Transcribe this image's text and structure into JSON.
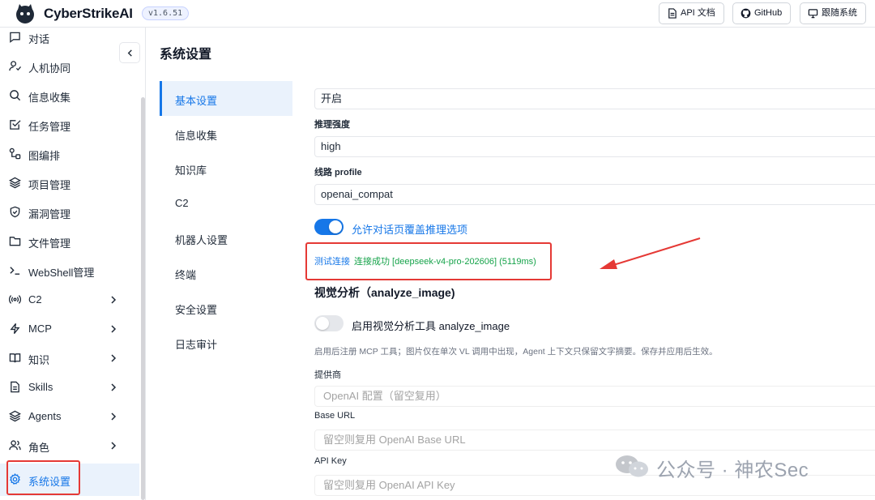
{
  "header": {
    "brand": "CyberStrikeAI",
    "version": "v1.6.51",
    "buttons": [
      {
        "label": "API 文档",
        "icon": "document-icon"
      },
      {
        "label": "GitHub",
        "icon": "github-icon"
      },
      {
        "label": "跟随系统",
        "icon": "monitor-icon"
      }
    ]
  },
  "sidebar": {
    "items": [
      {
        "label": "对话",
        "icon": "chat-icon"
      },
      {
        "label": "人机协同",
        "icon": "user-check-icon"
      },
      {
        "label": "信息收集",
        "icon": "search-icon"
      },
      {
        "label": "任务管理",
        "icon": "task-check-icon"
      },
      {
        "label": "图编排",
        "icon": "workflow-icon"
      },
      {
        "label": "项目管理",
        "icon": "layers-icon"
      },
      {
        "label": "漏洞管理",
        "icon": "shield-icon"
      },
      {
        "label": "文件管理",
        "icon": "folder-icon"
      },
      {
        "label": "WebShell管理",
        "icon": "terminal-icon"
      },
      {
        "label": "C2",
        "icon": "broadcast-icon",
        "expandable": true
      },
      {
        "label": "MCP",
        "icon": "bolt-icon",
        "expandable": true
      },
      {
        "label": "知识",
        "icon": "book-icon",
        "expandable": true
      },
      {
        "label": "Skills",
        "icon": "file-text-icon",
        "expandable": true
      },
      {
        "label": "Agents",
        "icon": "layers-icon",
        "expandable": true
      },
      {
        "label": "角色",
        "icon": "users-icon",
        "expandable": true
      },
      {
        "label": "系统设置",
        "icon": "gear-icon",
        "active": true
      }
    ]
  },
  "main": {
    "title": "系统设置",
    "subnav": [
      "基本设置",
      "信息收集",
      "知识库",
      "C2",
      "机器人设置",
      "终端",
      "安全设置",
      "日志审计"
    ],
    "active_subnav": "基本设置",
    "fields": {
      "thinking_value": "开启",
      "reasoning_label": "推理强度",
      "reasoning_value": "high",
      "profile_label": "线路 profile",
      "profile_value": "openai_compat",
      "override_toggle_label": "允许对话页覆盖推理选项",
      "override_toggle_on": true,
      "test_link": "测试连接",
      "test_result": "连接成功 [deepseek-v4-pro-202606] (5119ms)",
      "vision_section_title": "视觉分析（analyze_image)",
      "vision_toggle_label": "启用视觉分析工具 analyze_image",
      "vision_toggle_on": false,
      "vision_hint": "启用后注册 MCP 工具；图片仅在单次 VL 调用中出现，Agent 上下文只保留文字摘要。保存并应用后生效。",
      "provider_label": "提供商",
      "provider_placeholder": "OpenAI 配置（留空复用）",
      "base_url_label": "Base URL",
      "base_url_placeholder": "留空则复用 OpenAI Base URL",
      "api_key_label": "API Key",
      "api_key_placeholder": "留空则复用 OpenAI API Key"
    }
  },
  "watermark": "公众号 · 神农Sec",
  "colors": {
    "accent": "#1677e8",
    "success": "#16a34a",
    "annotation_red": "#e53935"
  }
}
